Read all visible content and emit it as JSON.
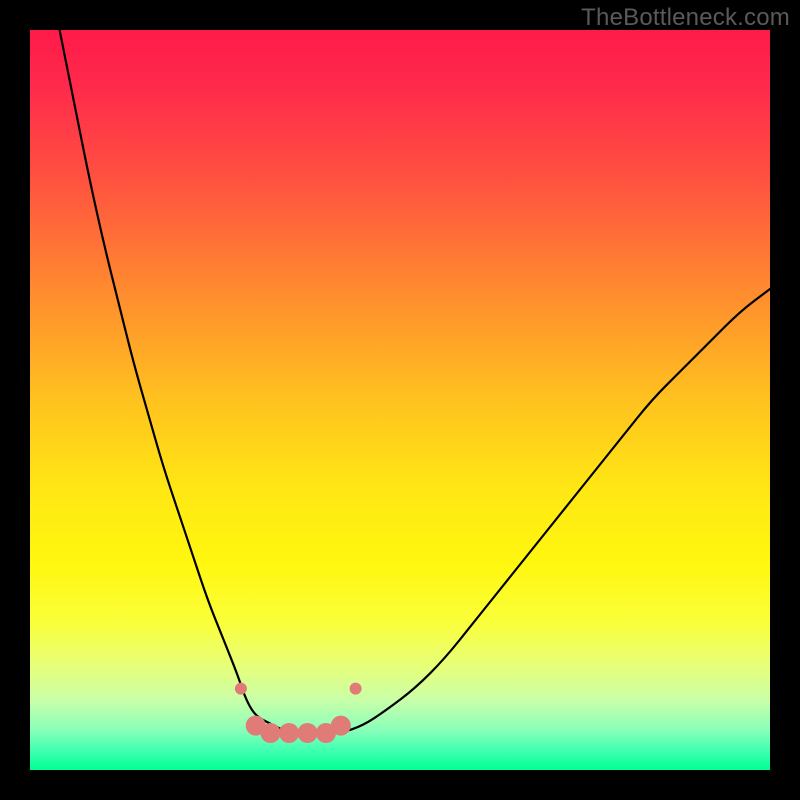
{
  "watermark": "TheBottleneck.com",
  "chart_data": {
    "type": "line",
    "title": "",
    "xlabel": "",
    "ylabel": "",
    "xlim": [
      0,
      100
    ],
    "ylim": [
      0,
      100
    ],
    "grid": false,
    "legend": false,
    "background_gradient": {
      "stops": [
        {
          "offset": 0.0,
          "color": "#ff1a4a"
        },
        {
          "offset": 0.08,
          "color": "#ff2b4b"
        },
        {
          "offset": 0.2,
          "color": "#ff5140"
        },
        {
          "offset": 0.35,
          "color": "#ff8a2f"
        },
        {
          "offset": 0.5,
          "color": "#ffc21f"
        },
        {
          "offset": 0.62,
          "color": "#ffe714"
        },
        {
          "offset": 0.72,
          "color": "#fff70f"
        },
        {
          "offset": 0.8,
          "color": "#faff3a"
        },
        {
          "offset": 0.86,
          "color": "#e7ff7a"
        },
        {
          "offset": 0.905,
          "color": "#c9ffa8"
        },
        {
          "offset": 0.945,
          "color": "#8bffb9"
        },
        {
          "offset": 0.975,
          "color": "#3dffb0"
        },
        {
          "offset": 1.0,
          "color": "#00ff94"
        }
      ]
    },
    "series": [
      {
        "name": "bottleneck-curve",
        "stroke": "#000000",
        "stroke_width": 2.2,
        "x": [
          4,
          6,
          8,
          10,
          12,
          14,
          16,
          18,
          20,
          22,
          24,
          26,
          28,
          29,
          30,
          31,
          33,
          35,
          37,
          40,
          42,
          45,
          48,
          52,
          56,
          60,
          64,
          68,
          72,
          76,
          80,
          84,
          88,
          92,
          96,
          100
        ],
        "values": [
          100,
          90,
          80,
          71,
          63,
          55,
          48,
          41,
          35,
          29,
          23,
          18,
          13,
          10,
          8,
          7,
          6,
          5,
          5,
          5,
          5,
          6,
          8,
          11,
          15,
          20,
          25,
          30,
          35,
          40,
          45,
          50,
          54,
          58,
          62,
          65
        ]
      }
    ],
    "markers": {
      "name": "valley-markers",
      "fill": "#e07b78",
      "radius_small": 6,
      "radius_large": 10,
      "points": [
        {
          "x": 28.5,
          "y": 11,
          "r": "small"
        },
        {
          "x": 30.5,
          "y": 6,
          "r": "large"
        },
        {
          "x": 32.5,
          "y": 5,
          "r": "large"
        },
        {
          "x": 35,
          "y": 5,
          "r": "large"
        },
        {
          "x": 37.5,
          "y": 5,
          "r": "large"
        },
        {
          "x": 40,
          "y": 5,
          "r": "large"
        },
        {
          "x": 42,
          "y": 6,
          "r": "large"
        },
        {
          "x": 44,
          "y": 11,
          "r": "small"
        }
      ]
    }
  }
}
